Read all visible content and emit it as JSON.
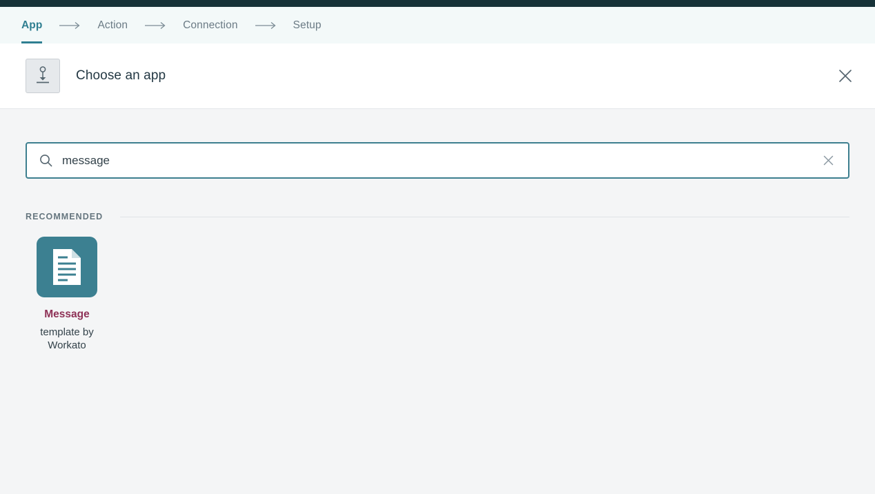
{
  "topbar": {
    "color": "#163238"
  },
  "wizard": {
    "tabs": [
      {
        "label": "App",
        "active": true
      },
      {
        "label": "Action",
        "active": false
      },
      {
        "label": "Connection",
        "active": false
      },
      {
        "label": "Setup",
        "active": false
      }
    ],
    "separator_icon": "arrow-right-icon",
    "accent_color": "#2f7f91"
  },
  "header": {
    "icon": "trigger-drop-icon",
    "title": "Choose an app",
    "close_icon": "close-icon"
  },
  "search": {
    "icon": "search-icon",
    "value": "message",
    "placeholder": "Search",
    "clear_icon": "clear-icon",
    "border_color": "#3d7f8f"
  },
  "section": {
    "label": "RECOMMENDED"
  },
  "apps": [
    {
      "icon": "document-icon",
      "icon_bg": "#3c8091",
      "name": "Message",
      "name_color": "#8e3156",
      "subtitle": "template by Workato"
    }
  ]
}
